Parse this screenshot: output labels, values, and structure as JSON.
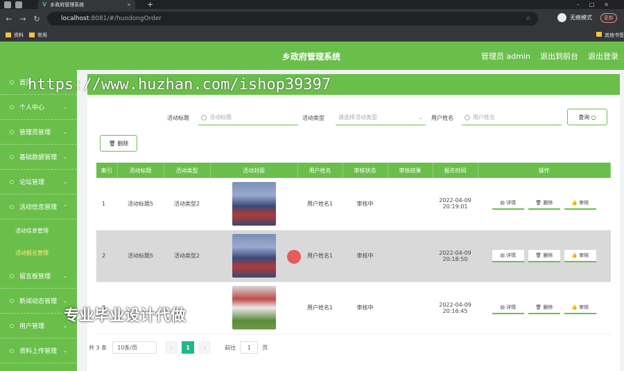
{
  "browser": {
    "tab_title": "乡政府管理系统",
    "tab_logo": "V",
    "new_tab": "+",
    "url_host": "localhost",
    "url_rest": ":8081/#/huodongOrder",
    "profile": "无痕模式",
    "update": "更新",
    "bookmarks": [
      "资料",
      "常用"
    ],
    "bookmarks_right": "其他书签"
  },
  "header": {
    "title": "乡政府管理系统",
    "links": [
      "管理员 admin",
      "退出到前台",
      "退出登录"
    ]
  },
  "sidebar": {
    "items": [
      {
        "label": "首页",
        "chevron": false
      },
      {
        "label": "个人中心",
        "chevron": true
      },
      {
        "label": "管理员管理",
        "chevron": true
      },
      {
        "label": "基础数据管理",
        "chevron": true
      },
      {
        "label": "论坛管理",
        "chevron": true
      },
      {
        "label": "活动信息管理",
        "chevron": true
      }
    ],
    "subitems": [
      "活动信息管理",
      "活动报名管理"
    ],
    "items2": [
      "留言板管理",
      "新闻动态管理",
      "用户管理",
      "资料上传管理"
    ]
  },
  "filters": {
    "title_label": "活动标题",
    "title_placeholder": "活动标题",
    "type_label": "活动类型",
    "type_placeholder": "请选择活动类型",
    "user_label": "用户姓名",
    "user_placeholder": "用户姓名",
    "query": "查询"
  },
  "delete_button": "删除",
  "table": {
    "headers": [
      "索引",
      "活动标题",
      "活动类型",
      "活动封面",
      "用户姓名",
      "审核状态",
      "审核结果",
      "报名时间",
      "操作"
    ],
    "rows": [
      {
        "idx": "1",
        "title": "活动标题5",
        "type": "活动类型2",
        "user": "用户姓名1",
        "status": "审核中",
        "result": "",
        "date": "2022-04-09",
        "time": "20:19:01"
      },
      {
        "idx": "2",
        "title": "活动标题5",
        "type": "活动类型2",
        "user": "用户姓名1",
        "status": "审核中",
        "result": "",
        "date": "2022-04-09",
        "time": "20:18:50"
      },
      {
        "idx": "3",
        "title": "",
        "type": "",
        "user": "用户姓名1",
        "status": "审核中",
        "result": "",
        "date": "2022-04-09",
        "time": "20:16:45"
      }
    ],
    "ops": [
      "详情",
      "删除",
      "审核"
    ]
  },
  "pager": {
    "total": "共 3 条",
    "size": "10条/页",
    "current": "1",
    "goto": "前往",
    "goto_value": "1",
    "page": "页"
  },
  "watermarks": {
    "url": "https://www.huzhan.com/ishop39397",
    "text": "专业毕业设计代做"
  }
}
